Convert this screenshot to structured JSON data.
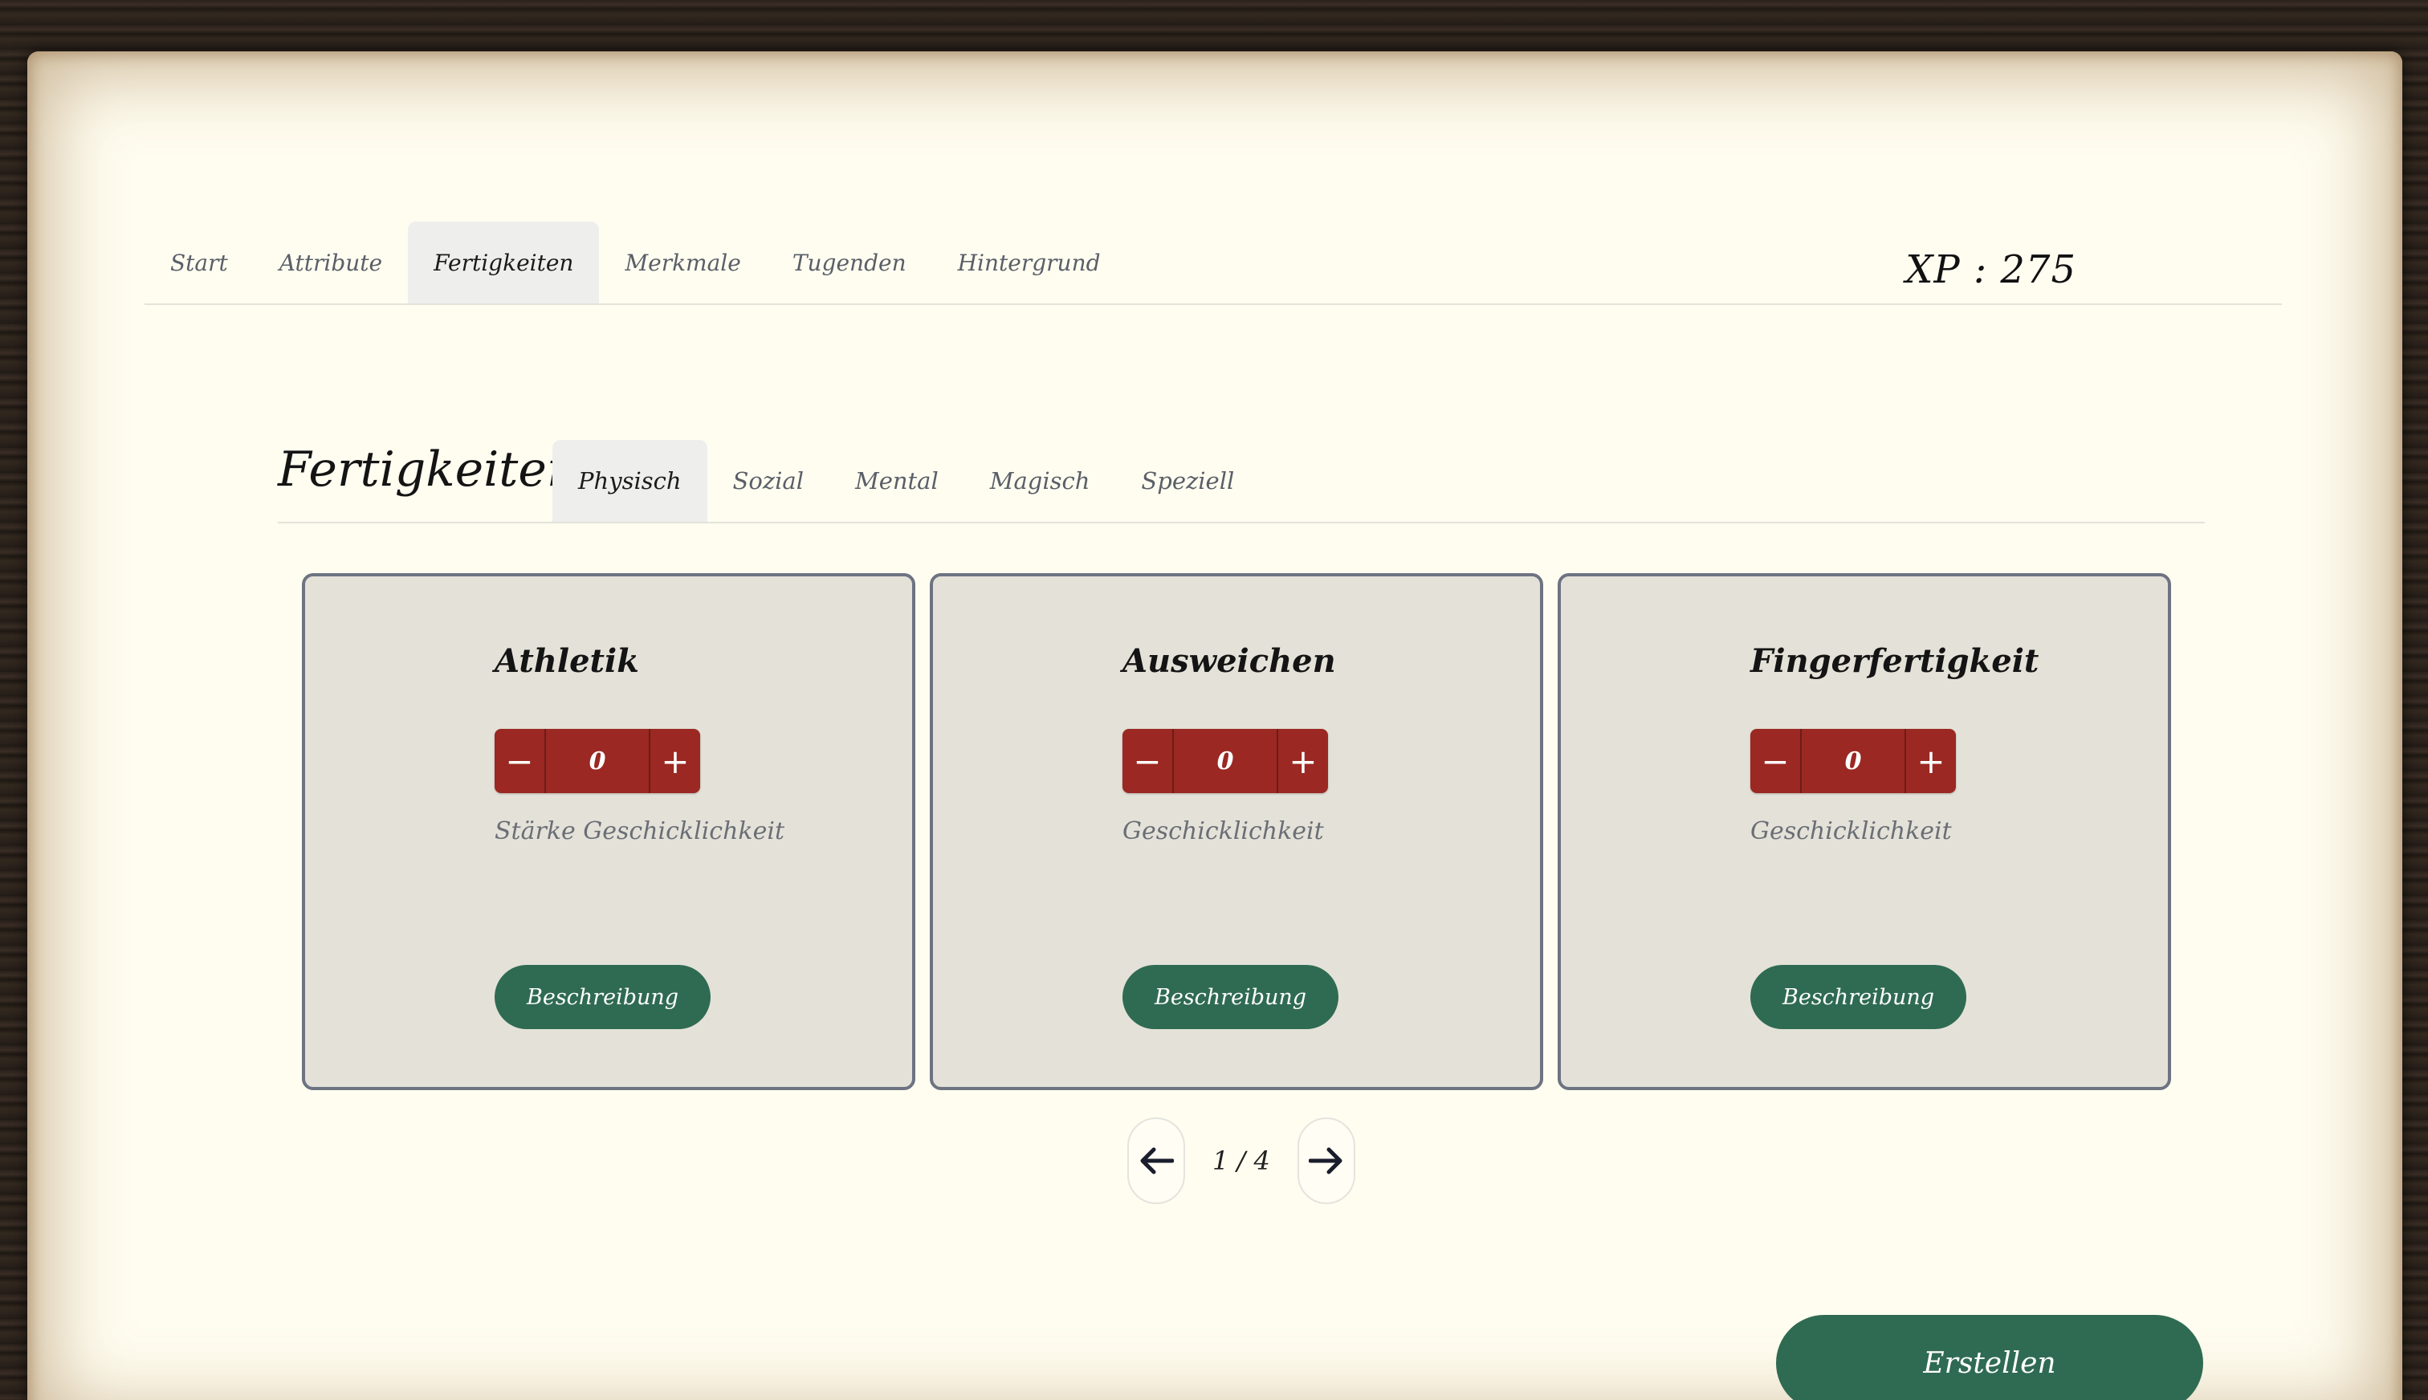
{
  "nav": {
    "tabs": [
      {
        "label": "Start"
      },
      {
        "label": "Attribute"
      },
      {
        "label": "Fertigkeiten"
      },
      {
        "label": "Merkmale"
      },
      {
        "label": "Tugenden"
      },
      {
        "label": "Hintergrund"
      }
    ],
    "active_tab": "Fertigkeiten",
    "xp_label": "XP : 275"
  },
  "section": {
    "title": "Fertigkeiten",
    "subtabs": [
      {
        "label": "Physisch"
      },
      {
        "label": "Sozial"
      },
      {
        "label": "Mental"
      },
      {
        "label": "Magisch"
      },
      {
        "label": "Speziell"
      }
    ],
    "active_subtab": "Physisch"
  },
  "cards": [
    {
      "title": "Athletik",
      "value": "0",
      "minus": "−",
      "plus": "+",
      "attributes": "Stärke Geschicklichkeit",
      "button": "Beschreibung"
    },
    {
      "title": "Ausweichen",
      "value": "0",
      "minus": "−",
      "plus": "+",
      "attributes": "Geschicklichkeit",
      "button": "Beschreibung"
    },
    {
      "title": "Fingerfertigkeit",
      "value": "0",
      "minus": "−",
      "plus": "+",
      "attributes": "Geschicklichkeit",
      "button": "Beschreibung"
    }
  ],
  "pagination": {
    "label": "1 / 4",
    "prev_icon": "arrow-left-icon",
    "next_icon": "arrow-right-icon"
  },
  "actions": {
    "create_label": "Erstellen"
  },
  "colors": {
    "paper": "#fffdf0",
    "card_bg": "#e4e2d8",
    "stepper_red": "#9b2822",
    "button_green": "#2f6b52"
  }
}
